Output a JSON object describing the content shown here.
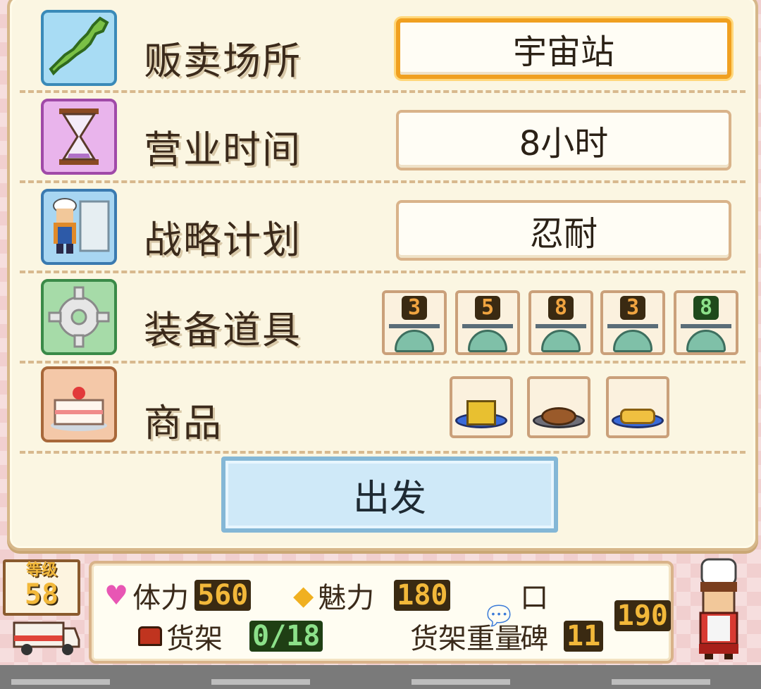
{
  "rows": [
    {
      "label": "贩卖场所",
      "value": "宇宙站",
      "icon": "japan-map-icon"
    },
    {
      "label": "营业时间",
      "value": "8小时",
      "icon": "hourglass-icon"
    },
    {
      "label": "战略计划",
      "value": "忍耐",
      "icon": "chef-icon"
    },
    {
      "label": "装备道具",
      "icon": "gear-icon"
    },
    {
      "label": "商品",
      "icon": "cake-icon"
    }
  ],
  "equipment": [
    "3",
    "5",
    "8",
    "3",
    "8"
  ],
  "goods": [
    "yellow-box-dish",
    "meat-dish",
    "bread-dish"
  ],
  "depart_label": "出发",
  "status": {
    "level_label": "等级",
    "level_value": "58",
    "stamina_label": "体力",
    "stamina_value": "560",
    "charm_label": "魅力",
    "charm_value": "180",
    "reputation_label": "口碑",
    "reputation_value": "190",
    "shelf_label": "货架",
    "shelf_value": "0/18",
    "shelf_weight_label": "货架重量",
    "shelf_weight_value": "11"
  },
  "colors": {
    "selected_border": "#f0a020",
    "depart_bg": "#cfe9f8",
    "panel_bg": "#fbf6e2"
  }
}
